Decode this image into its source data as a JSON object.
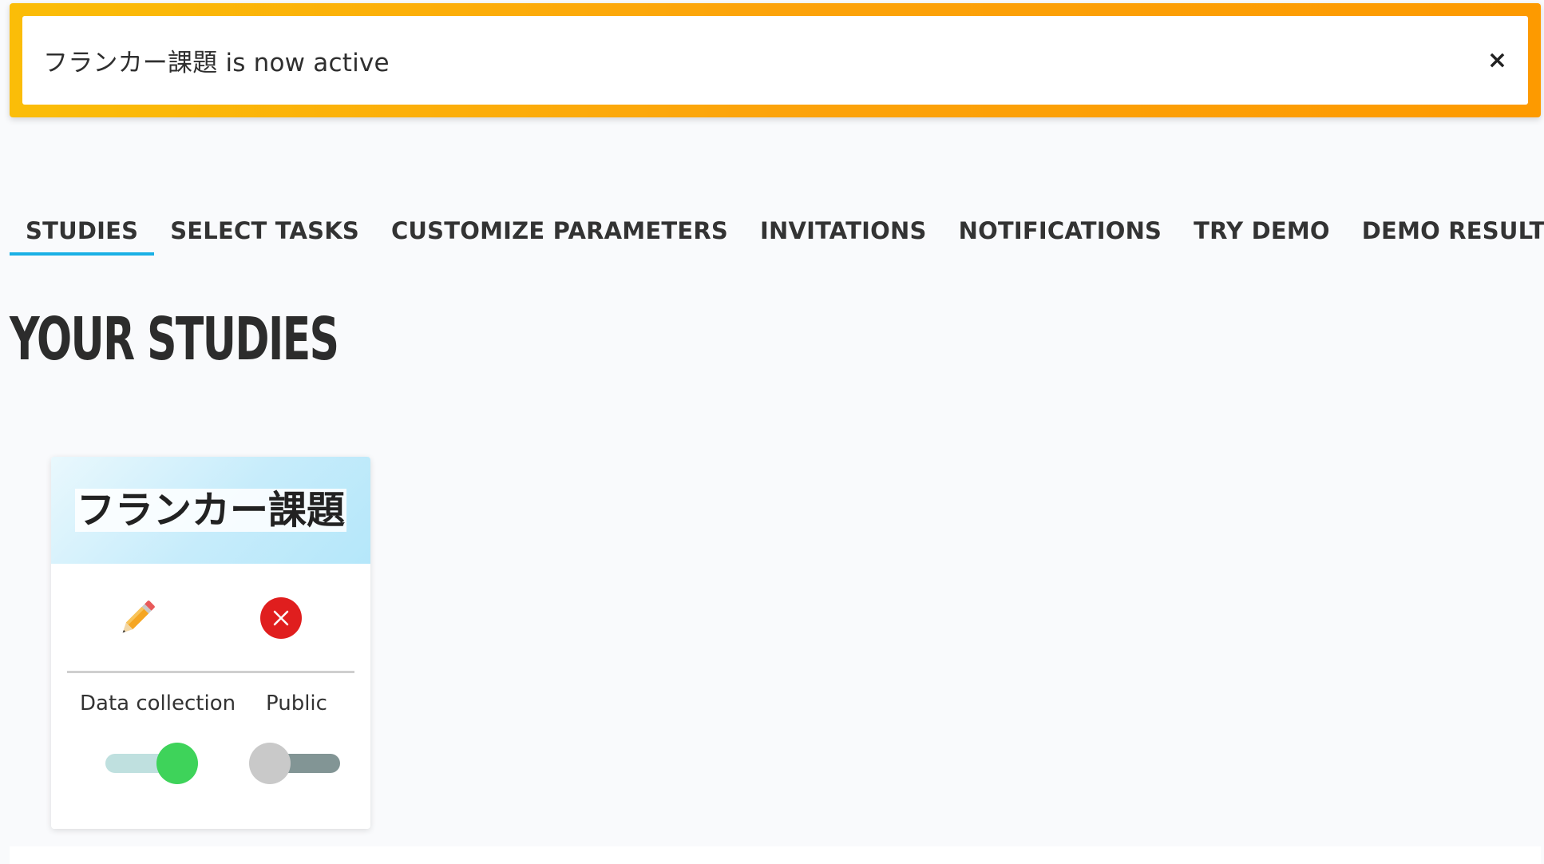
{
  "notification": {
    "message": "フランカー課題 is now active",
    "close_label": "×"
  },
  "tabs": [
    {
      "label": "STUDIES",
      "active": true
    },
    {
      "label": "SELECT TASKS",
      "active": false
    },
    {
      "label": "CUSTOMIZE PARAMETERS",
      "active": false
    },
    {
      "label": "INVITATIONS",
      "active": false
    },
    {
      "label": "NOTIFICATIONS",
      "active": false
    },
    {
      "label": "TRY DEMO",
      "active": false
    },
    {
      "label": "DEMO RESULTS",
      "active": false
    }
  ],
  "page_title": "YOUR STUDIES",
  "study_card": {
    "title": "フランカー課題",
    "edit_icon": "pencil-icon",
    "delete_icon": "close-circle-icon",
    "toggles": [
      {
        "label": "Data collection",
        "on": true
      },
      {
        "label": "Public",
        "on": false
      }
    ]
  },
  "colors": {
    "notice_border": "#fbbd08",
    "tab_underline": "#1ab0e5",
    "toggle_on_knob": "#3ed35a",
    "toggle_on_track": "#bfe0df",
    "toggle_off_knob": "#c9c9c9",
    "toggle_off_track": "#829595",
    "delete_red": "#e01e1e"
  }
}
